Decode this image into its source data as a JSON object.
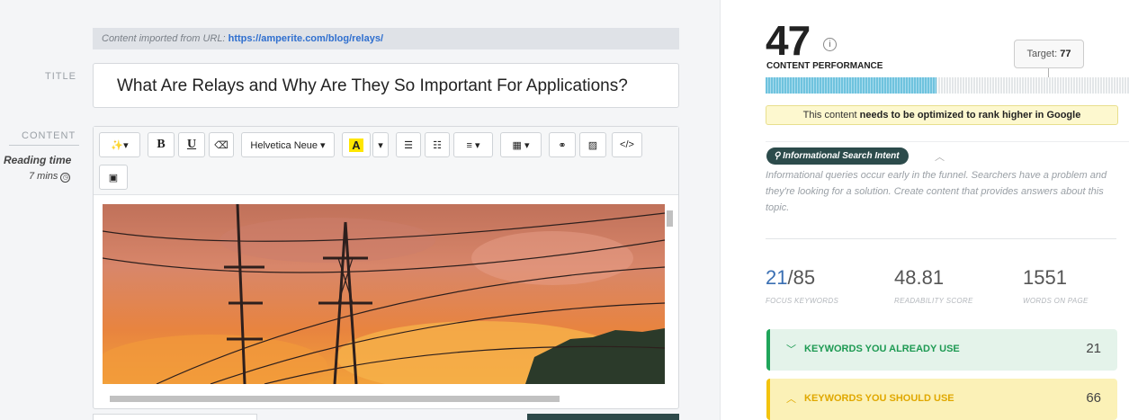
{
  "editor": {
    "import_notice": "Content imported from URL:",
    "import_url": "https://amperite.com/blog/relays/",
    "title_label": "TITLE",
    "title_value": "What Are Relays and Why Are They So Important For Applications?",
    "content_label": "CONTENT",
    "reading_time_label": "Reading time",
    "reading_time_value": "7 mins",
    "toolbar": {
      "magic": "✨▾",
      "bold": "B",
      "underline": "U",
      "eraser": "⌫",
      "font_family": "Helvetica Neue ▾",
      "font_color": "A",
      "font_color_dropdown": "▾",
      "bullet_list": "☰",
      "numbered_list": "☷",
      "align": "≡ ▾",
      "table": "▦ ▾",
      "link": "⚭",
      "image": "▨",
      "code": "</>",
      "paste": "▣"
    }
  },
  "panel": {
    "score": "47",
    "score_label": "CONTENT PERFORMANCE",
    "target_label": "Target:",
    "target_value": "77",
    "score_fraction": 0.47,
    "notice_pre": "This content",
    "notice_bold": "needs to be optimized to rank higher in Google",
    "intent_badge": "Informational Search Intent",
    "intent_description": "Informational queries occur early in the funnel. Searchers have a problem and they're looking for a solution. Create content that provides answers about this topic.",
    "stats": [
      {
        "value_hl": "21",
        "value_rest": "/85",
        "caption": "FOCUS KEYWORDS"
      },
      {
        "value_hl": "",
        "value_rest": "48.81",
        "caption": "READABILITY SCORE"
      },
      {
        "value_hl": "",
        "value_rest": "1551",
        "caption": "WORDS ON PAGE"
      }
    ],
    "keyword_sections": [
      {
        "label": "KEYWORDS YOU ALREADY USE",
        "count": "21",
        "color": "#1fa55a"
      },
      {
        "label": "KEYWORDS YOU SHOULD USE",
        "count": "66",
        "color": "#f3c30e"
      }
    ]
  }
}
